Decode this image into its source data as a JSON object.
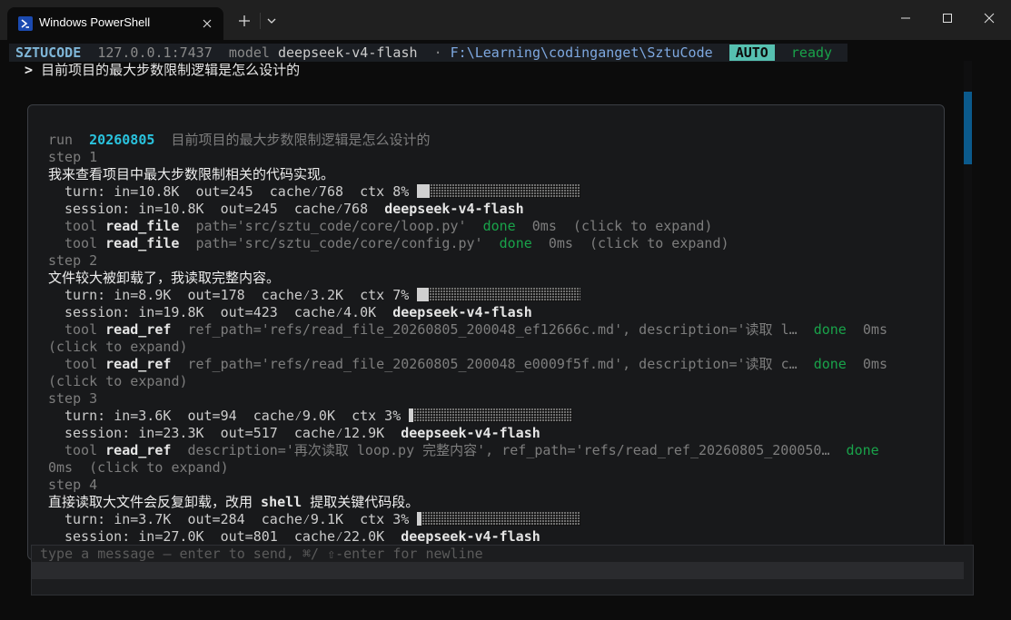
{
  "window": {
    "tab_title": "Windows PowerShell",
    "new_tab_symbol": "+",
    "icons": [
      "powershell-icon",
      "close-icon",
      "plus-icon",
      "chevron-down-icon",
      "minimize-icon",
      "maximize-icon",
      "close-icon"
    ]
  },
  "status": {
    "brand": "SZTUCODE",
    "address": "127.0.0.1:7437",
    "model_label": "model",
    "model": "deepseek-v4-flash",
    "sep": "·",
    "path": "F:\\Learning\\codinganget\\SztuCode",
    "mode": "AUTO",
    "state": "ready"
  },
  "prompt": {
    "marker": ">",
    "text": "目前项目的最大步数限制逻辑是怎么设计的"
  },
  "run": {
    "label": "run",
    "id": "20260805",
    "title": "目前项目的最大步数限制逻辑是怎么设计的"
  },
  "steps": [
    {
      "label": "step 1",
      "message": "我来查看项目中最大步数限制相关的代码实现。",
      "turn": {
        "label": "turn:",
        "in": "in=10.8K",
        "out": "out=245",
        "cache": "cache⁄768",
        "ctx": "ctx 8%",
        "ctx_pct": 8
      },
      "session": {
        "label": "session:",
        "in": "in=10.8K",
        "out": "out=245",
        "cache": "cache⁄768",
        "model": "deepseek-v4-flash"
      },
      "tools": [
        {
          "label": "tool",
          "name": "read_file",
          "args": "path='src/sztu_code/core/loop.py'",
          "status": "done",
          "time": "0ms",
          "hint": "(click to expand)"
        },
        {
          "label": "tool",
          "name": "read_file",
          "args": "path='src/sztu_code/core/config.py'",
          "status": "done",
          "time": "0ms",
          "hint": "(click to expand)"
        }
      ]
    },
    {
      "label": "step 2",
      "message": "文件较大被卸载了，我读取完整内容。",
      "turn": {
        "label": "turn:",
        "in": "in=8.9K",
        "out": "out=178",
        "cache": "cache⁄3.2K",
        "ctx": "ctx 7%",
        "ctx_pct": 7
      },
      "session": {
        "label": "session:",
        "in": "in=19.8K",
        "out": "out=423",
        "cache": "cache⁄4.0K",
        "model": "deepseek-v4-flash"
      },
      "tools": [
        {
          "label": "tool",
          "name": "read_ref",
          "args": "ref_path='refs/read_file_20260805_200048_ef12666c.md', description='读取 l…",
          "status": "done",
          "time": "0ms",
          "hint": "(click to expand)"
        },
        {
          "label": "tool",
          "name": "read_ref",
          "args": "ref_path='refs/read_file_20260805_200048_e0009f5f.md', description='读取 c…",
          "status": "done",
          "time": "0ms",
          "hint": "(click to expand)"
        }
      ]
    },
    {
      "label": "step 3",
      "message": "",
      "turn": {
        "label": "turn:",
        "in": "in=3.6K",
        "out": "out=94",
        "cache": "cache⁄9.0K",
        "ctx": "ctx 3%",
        "ctx_pct": 3
      },
      "session": {
        "label": "session:",
        "in": "in=23.3K",
        "out": "out=517",
        "cache": "cache⁄12.9K",
        "model": "deepseek-v4-flash"
      },
      "tools": [
        {
          "label": "tool",
          "name": "read_ref",
          "args": "description='再次读取 loop.py 完整内容', ref_path='refs/read_ref_20260805_200050…",
          "status": "done",
          "time": "0ms",
          "hint": "(click to expand)"
        }
      ]
    },
    {
      "label": "step 4",
      "message_pre": "直接读取大文件会反复卸载，改用 ",
      "message_code": "shell",
      "message_post": " 提取关键代码段。",
      "turn": {
        "label": "turn:",
        "in": "in=3.7K",
        "out": "out=284",
        "cache": "cache⁄9.1K",
        "ctx": "ctx 3%",
        "ctx_pct": 3
      },
      "session": {
        "label": "session:",
        "in": "in=27.0K",
        "out": "out=801",
        "cache": "cache⁄22.0K",
        "model": "deepseek-v4-flash"
      }
    }
  ],
  "input": {
    "placeholder": "type a message — enter to send, ⌘/ ⇧-enter for newline"
  }
}
